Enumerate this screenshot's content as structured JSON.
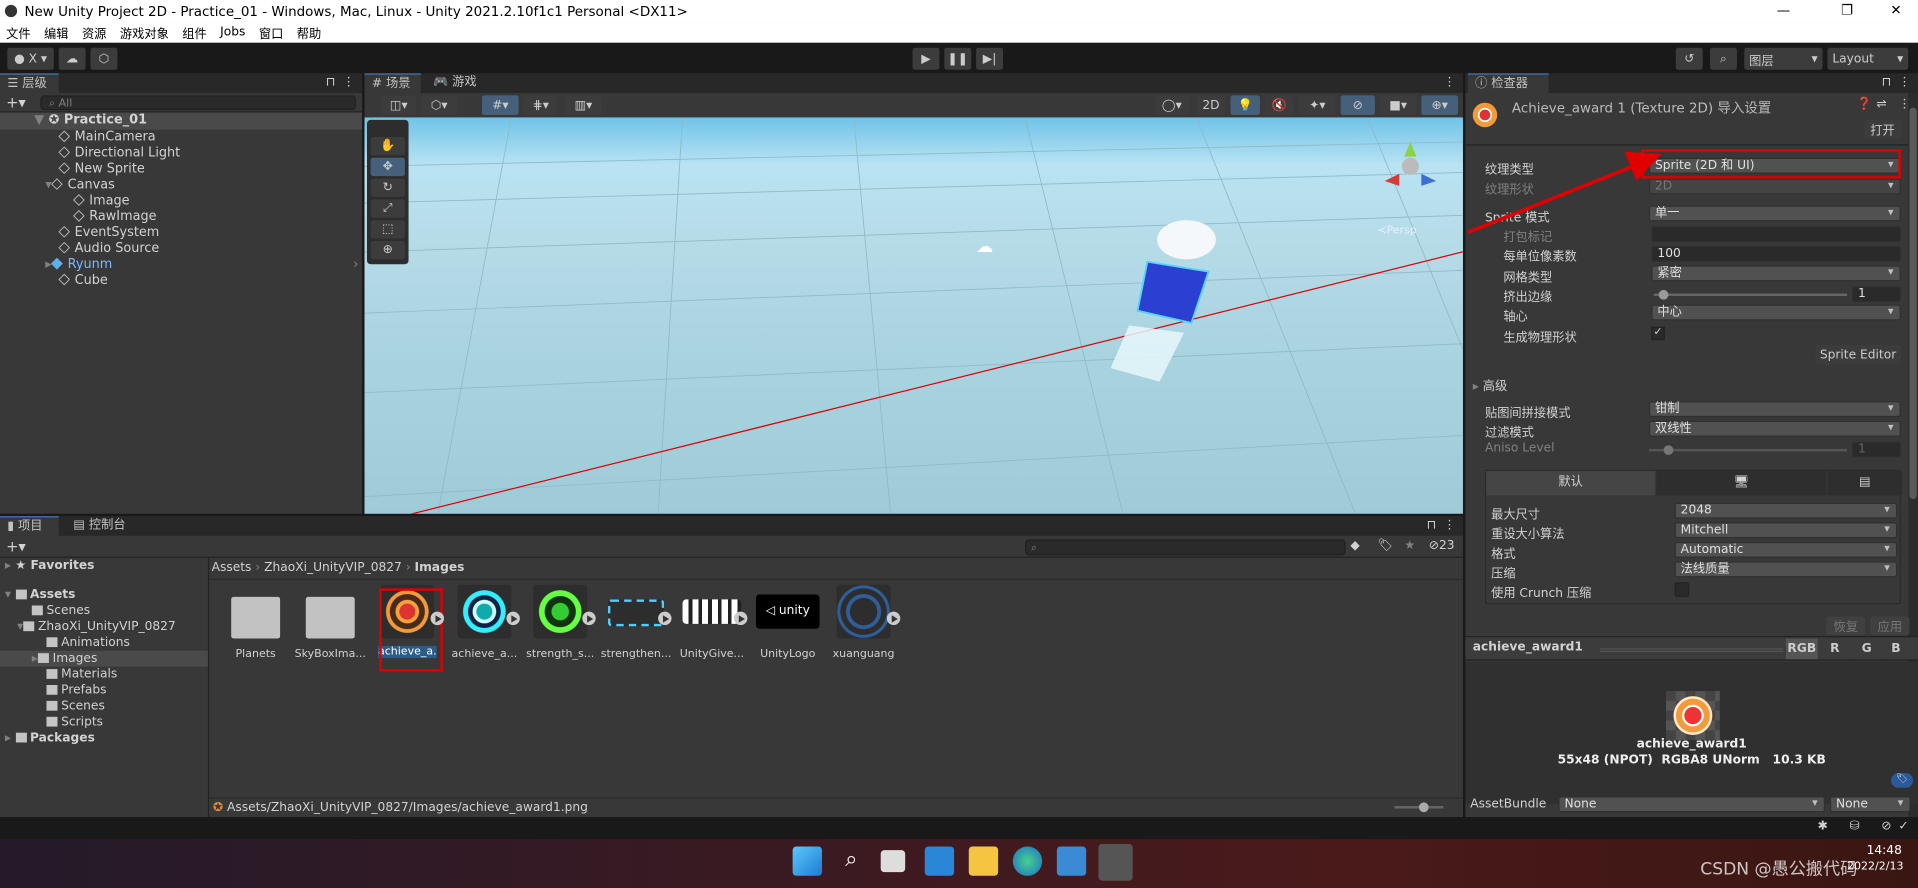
{
  "window": {
    "title": "New Unity Project 2D - Practice_01 - Windows, Mac, Linux - Unity 2021.2.10f1c1 Personal <DX11>",
    "minimize": "—",
    "maximize": "❐",
    "close": "✕"
  },
  "menu": [
    "文件",
    "编辑",
    "资源",
    "游戏对象",
    "组件",
    "Jobs",
    "窗口",
    "帮助"
  ],
  "toolbar": {
    "account": "X",
    "layers": "图层",
    "layout": "Layout"
  },
  "hierarchy": {
    "tab": "层级",
    "search_placeholder": "All",
    "scene": "Practice_01",
    "items": [
      {
        "label": "MainCamera"
      },
      {
        "label": "Directional Light"
      },
      {
        "label": "New Sprite"
      },
      {
        "label": "Canvas"
      },
      {
        "label": "Image"
      },
      {
        "label": "RawImage"
      },
      {
        "label": "EventSystem"
      },
      {
        "label": "Audio Source"
      },
      {
        "label": "Ryunm"
      },
      {
        "label": "Cube"
      }
    ]
  },
  "scene": {
    "tab_scene": "场景",
    "tab_game": "游戏",
    "btn_2d": "2D",
    "persp": "≺Persp",
    "gizmo_axes": [
      "y",
      "x",
      "z"
    ]
  },
  "project": {
    "tab_project": "项目",
    "tab_console": "控制台",
    "hidden_count": "23",
    "tree": {
      "favorites": "Favorites",
      "assets": "Assets",
      "scenes": "Scenes",
      "zhaoxi": "ZhaoXi_UnityVIP_0827",
      "animations": "Animations",
      "images": "Images",
      "materials": "Materials",
      "prefabs": "Prefabs",
      "scenes2": "Scenes",
      "scripts": "Scripts",
      "packages": "Packages"
    },
    "breadcrumb": [
      "Assets",
      "ZhaoXi_UnityVIP_0827",
      "Images"
    ],
    "assets": [
      {
        "name": "Planets"
      },
      {
        "name": "SkyBoxIma..."
      },
      {
        "name": "achieve_a..."
      },
      {
        "name": "achieve_a..."
      },
      {
        "name": "strength_s..."
      },
      {
        "name": "strengthen..."
      },
      {
        "name": "UnityGive..."
      },
      {
        "name": "UnityLogo"
      },
      {
        "name": "xuanguang"
      }
    ],
    "selected_path": "Assets/ZhaoXi_UnityVIP_0827/Images/achieve_award1.png"
  },
  "inspector": {
    "tab": "检查器",
    "title": "Achieve_award 1 (Texture 2D) 导入设置",
    "open": "打开",
    "texture_type_label": "纹理类型",
    "texture_type": "Sprite (2D 和 UI)",
    "texture_shape_label": "纹理形状",
    "texture_shape": "2D",
    "sprite_mode_label": "Sprite 模式",
    "sprite_mode": "单一",
    "packing_tag_label": "打包标记",
    "packing_tag": "",
    "ppu_label": "每单位像素数",
    "ppu": "100",
    "mesh_type_label": "网格类型",
    "mesh_type": "紧密",
    "extrude_label": "挤出边缘",
    "extrude": "1",
    "pivot_label": "轴心",
    "pivot": "中心",
    "physics_label": "生成物理形状",
    "physics_checked": true,
    "sprite_editor": "Sprite Editor",
    "advanced": "高级",
    "wrap_label": "贴图间拼接模式",
    "wrap": "钳制",
    "filter_label": "过滤模式",
    "filter": "双线性",
    "aniso_label": "Aniso Level",
    "aniso": "1",
    "platform_default": "默认",
    "max_size_label": "最大尺寸",
    "max_size": "2048",
    "resize_label": "重设大小算法",
    "resize": "Mitchell",
    "format_label": "格式",
    "format": "Automatic",
    "compression_label": "压缩",
    "compression": "法线质量",
    "crunch_label": "使用 Crunch 压缩",
    "crunch_checked": false,
    "revert": "恢复",
    "apply": "应用",
    "preview_name": "achieve_award1",
    "channels": [
      "RGB",
      "R",
      "G",
      "B"
    ],
    "preview_caption": "achieve_award1",
    "preview_info": "55x48 (NPOT)  RGBA8 UNorm   10.3 KB",
    "assetbundle_label": "AssetBundle",
    "assetbundle": "None",
    "assetbundle_variant": "None"
  },
  "taskbar": {
    "time": "14:48",
    "date": "2022/2/13",
    "watermark": "CSDN @愚公搬代码"
  },
  "colors": {
    "accent": "#3a79bb",
    "annotation": "#ff0000",
    "panel": "#383838",
    "selection": "#2c5d87"
  }
}
